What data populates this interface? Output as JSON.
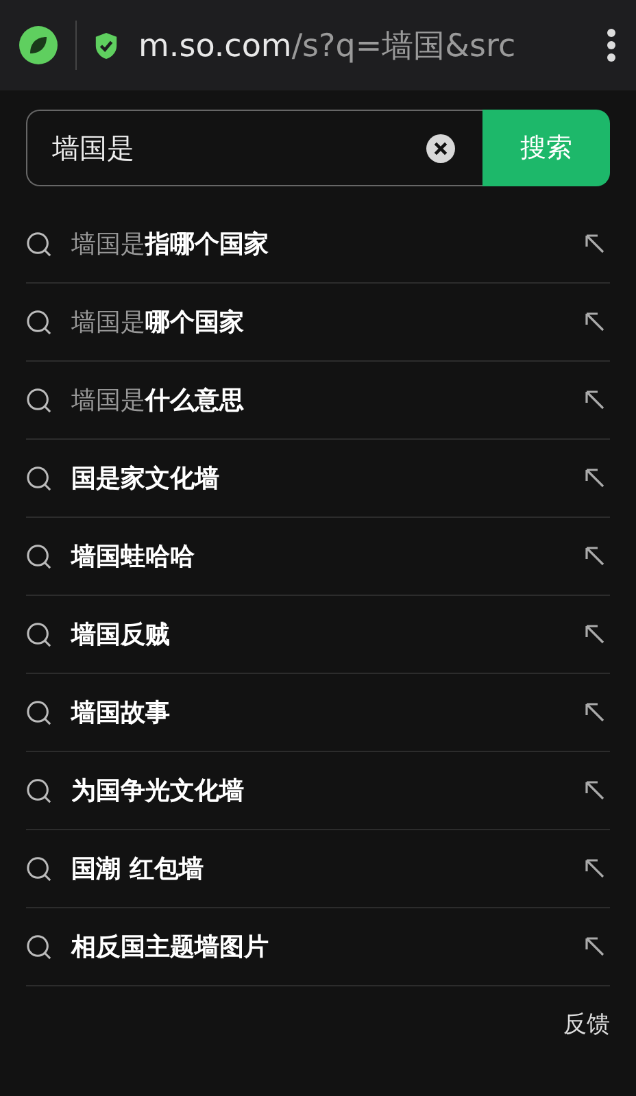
{
  "address_bar": {
    "host": "m.so.com",
    "path": "/s?q=墙国&src"
  },
  "search": {
    "value": "墙国是",
    "button": "搜索"
  },
  "suggestions": [
    {
      "match": "墙国是",
      "completion": "指哪个国家"
    },
    {
      "match": "墙国是",
      "completion": "哪个国家"
    },
    {
      "match": "墙国是",
      "completion": "什么意思"
    },
    {
      "completion": "国是家文化墙"
    },
    {
      "completion": "墙国蛙哈哈"
    },
    {
      "completion": "墙国反贼"
    },
    {
      "completion": "墙国故事"
    },
    {
      "completion": "为国争光文化墙"
    },
    {
      "completion": "国潮 红包墙"
    },
    {
      "completion": "相反国主题墙图片"
    }
  ],
  "feedback": "反馈"
}
